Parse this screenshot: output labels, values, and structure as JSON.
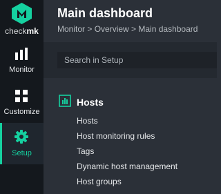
{
  "brand": {
    "name_prefix": "check",
    "name_suffix": "mk",
    "accent_color": "#15d1a0"
  },
  "sidebar": {
    "items": [
      {
        "label": "Monitor",
        "icon": "bar-chart-icon",
        "active": false
      },
      {
        "label": "Customize",
        "icon": "grid-icon",
        "active": false
      },
      {
        "label": "Setup",
        "icon": "gear-icon",
        "active": true
      }
    ]
  },
  "header": {
    "title": "Main dashboard",
    "breadcrumb": "Monitor > Overview > Main dashboard"
  },
  "search": {
    "placeholder": "Search in Setup",
    "value": ""
  },
  "section": {
    "title": "Hosts",
    "icon": "hosts-icon",
    "items": [
      "Hosts",
      "Host monitoring rules",
      "Tags",
      "Dynamic host management",
      "Host groups"
    ]
  }
}
